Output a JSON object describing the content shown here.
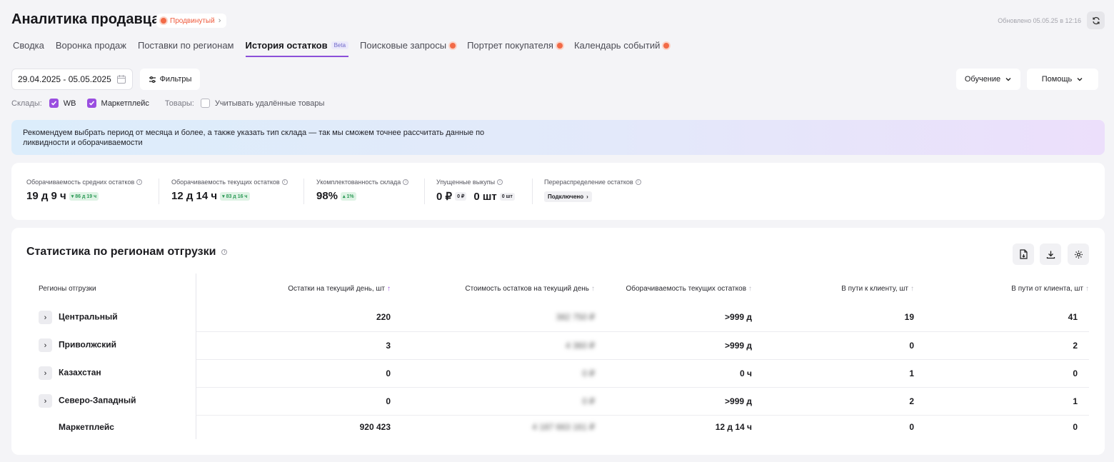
{
  "header": {
    "title": "Аналитика продавца",
    "plan_badge": "Продвинутый",
    "updated": "Обновлено 05.05.25 в 12:16"
  },
  "tabs": [
    {
      "label": "Сводка",
      "active": false
    },
    {
      "label": "Воронка продаж",
      "active": false
    },
    {
      "label": "Поставки по регионам",
      "active": false
    },
    {
      "label": "История остатков",
      "active": true,
      "badge": "Beta"
    },
    {
      "label": "Поисковые запросы",
      "active": false,
      "dot": true
    },
    {
      "label": "Портрет покупателя",
      "active": false,
      "dot": true
    },
    {
      "label": "Календарь событий",
      "active": false,
      "dot": true
    }
  ],
  "toolbar": {
    "date_range": "29.04.2025 - 05.05.2025",
    "filters_label": "Фильтры",
    "learning_label": "Обучение",
    "help_label": "Помощь"
  },
  "filters": {
    "warehouses_label": "Склады:",
    "wb_label": "WB",
    "marketplace_label": "Маркетплейс",
    "goods_label": "Товары:",
    "deleted_label": "Учитывать удалённые товары",
    "wb_checked": true,
    "marketplace_checked": true,
    "deleted_checked": false
  },
  "banner": {
    "line1": "Рекомендуем выбрать период от месяца и более, а также указать тип склада — так мы сможем точнее рассчитать данные по",
    "line2": "ликвидности и оборачиваемости"
  },
  "metrics": {
    "avg_turnover": {
      "label": "Оборачиваемость средних остатков",
      "value": "19 д 9 ч",
      "delta": "86 д 19 ч"
    },
    "cur_turnover": {
      "label": "Оборачиваемость текущих остатков",
      "value": "12 д 14 ч",
      "delta": "83 д 16 ч"
    },
    "completeness": {
      "label": "Укомплектованность склада",
      "value": "98%",
      "delta": "1%"
    },
    "missed": {
      "label": "Упущенные выкупы",
      "value_rub": "0 ₽",
      "chip_rub": "0 ₽",
      "value_pcs": "0 шт",
      "chip_pcs": "0 шт"
    },
    "redistribution": {
      "label": "Перераспределение остатков",
      "status": "Подключено"
    }
  },
  "stats": {
    "title": "Статистика по регионам отгрузки",
    "columns": [
      "Регионы отгрузки",
      "Остатки на текущий день, шт",
      "Стоимость остатков на текущий день",
      "Оборачиваемость текущих остатков",
      "В пути к клиенту, шт",
      "В пути от клиента, шт"
    ],
    "rows": [
      {
        "region": "Центральный",
        "stock": "220",
        "cost": "382 750 ₽",
        "turnover": ">999 д",
        "to_client": "19",
        "from_client": "41"
      },
      {
        "region": "Приволжский",
        "stock": "3",
        "cost": "4 360 ₽",
        "turnover": ">999 д",
        "to_client": "0",
        "from_client": "2"
      },
      {
        "region": "Казахстан",
        "stock": "0",
        "cost": "0 ₽",
        "turnover": "0 ч",
        "to_client": "1",
        "from_client": "0"
      },
      {
        "region": "Северо-Западный",
        "stock": "0",
        "cost": "0 ₽",
        "turnover": ">999 д",
        "to_client": "2",
        "from_client": "1"
      }
    ],
    "total": {
      "region": "Маркетплейс",
      "stock": "920 423",
      "cost": "4 187 663 161 ₽",
      "turnover": "12 д 14 ч",
      "to_client": "0",
      "from_client": "0"
    }
  },
  "colors": {
    "accent": "#9a4ee0",
    "notice": "#f26a47",
    "positive": "#2e9b58"
  }
}
